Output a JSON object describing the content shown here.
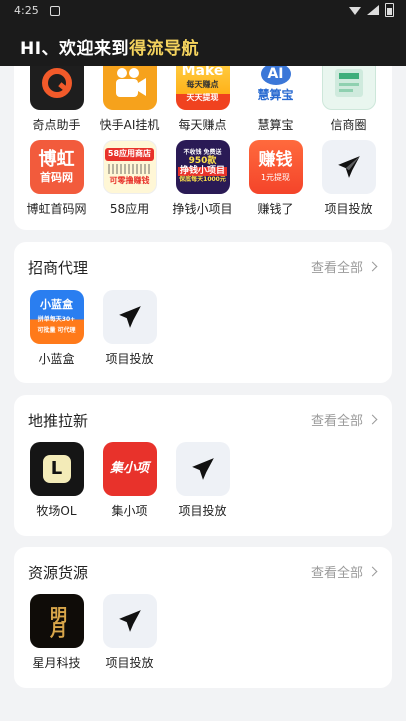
{
  "status": {
    "time": "4:25"
  },
  "header": {
    "title_prefix": "HI、欢迎来到",
    "title_highlight": "得流导航"
  },
  "top_card": {
    "row1": [
      {
        "label": "奇点助手",
        "icon": "qidian-logo-icon"
      },
      {
        "label": "快手AI挂机",
        "icon": "kuaishou-logo-icon"
      },
      {
        "label": "每天赚点",
        "icon": "make-logo-icon",
        "badge_top": "Make",
        "badge_mid": "每天赚点",
        "badge_bottom": "天天提现"
      },
      {
        "label": "慧算宝",
        "icon": "huisuanbao-logo-icon",
        "badge_top": "AI",
        "badge_bottom": "慧算宝"
      },
      {
        "label": "信商圈",
        "icon": "xinshangquan-logo-icon"
      }
    ],
    "row2": [
      {
        "label": "博虹首码网",
        "icon": "bohong-logo-icon",
        "badge_top": "博虹",
        "badge_bottom": "首码网"
      },
      {
        "label": "58应用",
        "icon": "app58-logo-icon",
        "badge_top": "58应用商店",
        "badge_bottom": "可零撸赚钱"
      },
      {
        "label": "挣钱小项目",
        "icon": "zhengqian-logo-icon",
        "badge_top": "不收钱 免费送",
        "badge_mid": "950款",
        "badge_main": "挣钱小项目",
        "badge_bottom": "保底每天1000元"
      },
      {
        "label": "赚钱了",
        "icon": "zhuanqian-logo-icon",
        "badge_top": "赚钱",
        "badge_bottom": "1元提现"
      },
      {
        "label": "项目投放",
        "icon": "paper-plane-icon"
      }
    ]
  },
  "sections": [
    {
      "title": "招商代理",
      "view_all": "查看全部",
      "items": [
        {
          "label": "小蓝盒",
          "icon": "xiaolanhe-logo-icon",
          "badge_top": "小蓝盒",
          "badge_mid": "拼单每天30+",
          "badge_bottom": "可批量 可代理"
        },
        {
          "label": "项目投放",
          "icon": "paper-plane-icon"
        }
      ]
    },
    {
      "title": "地推拉新",
      "view_all": "查看全部",
      "items": [
        {
          "label": "牧场OL",
          "icon": "muchang-logo-icon",
          "badge_top": "L"
        },
        {
          "label": "集小项",
          "icon": "jixiaoxiang-logo-icon",
          "badge_top": "集小项"
        },
        {
          "label": "项目投放",
          "icon": "paper-plane-icon"
        }
      ]
    },
    {
      "title": "资源货源",
      "view_all": "查看全部",
      "items": [
        {
          "label": "星月科技",
          "icon": "xingyue-logo-icon",
          "badge_top": "明月"
        },
        {
          "label": "项目投放",
          "icon": "paper-plane-icon"
        }
      ]
    }
  ],
  "colors": {
    "header_bg": "#1b1b1b",
    "highlight": "#f4d35e",
    "page_bg": "#f2f3f5"
  }
}
